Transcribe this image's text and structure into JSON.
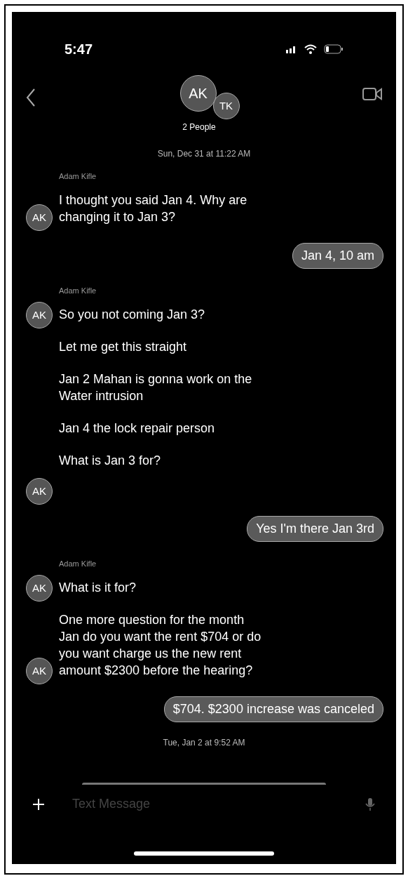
{
  "status_bar": {
    "time": "5:47"
  },
  "header": {
    "avatars": [
      "AK",
      "TK"
    ],
    "title": "2 People"
  },
  "messages": [
    {
      "kind": "timestamp",
      "text": "Sun, Dec 31 at 11:22 AM"
    },
    {
      "kind": "sender",
      "text": "Adam Kifle"
    },
    {
      "kind": "incoming",
      "text": "I thought you said Jan 4. Why are changing it to Jan 3?",
      "avatar": "AK"
    },
    {
      "kind": "outgoing",
      "text": "Jan 4, 10 am"
    },
    {
      "kind": "sender",
      "text": "Adam Kifle"
    },
    {
      "kind": "incoming",
      "text": "So you not coming Jan 3?",
      "avatar": "AK"
    },
    {
      "kind": "incoming",
      "text": "Let me get this straight"
    },
    {
      "kind": "incoming",
      "text": "Jan 2 Mahan is gonna work on the Water intrusion"
    },
    {
      "kind": "incoming",
      "text": "Jan 4 the lock repair person"
    },
    {
      "kind": "incoming",
      "text": "What is Jan 3 for?"
    },
    {
      "kind": "avatar",
      "text": "AK"
    },
    {
      "kind": "outgoing",
      "text": "Yes I'm there Jan 3rd"
    },
    {
      "kind": "sender",
      "text": "Adam Kifle"
    },
    {
      "kind": "incoming",
      "text": "What is it for?",
      "avatar": "AK"
    },
    {
      "kind": "incoming",
      "text": "One more question for the month Jan do you want the rent $704 or do you want charge us the new rent amount $2300 before the hearing?",
      "avatar": "AK"
    },
    {
      "kind": "outgoing",
      "text": "$704. $2300 increase was canceled"
    },
    {
      "kind": "timestamp",
      "text": "Tue, Jan 2 at 9:52 AM"
    }
  ],
  "composer": {
    "placeholder": "Text Message"
  }
}
